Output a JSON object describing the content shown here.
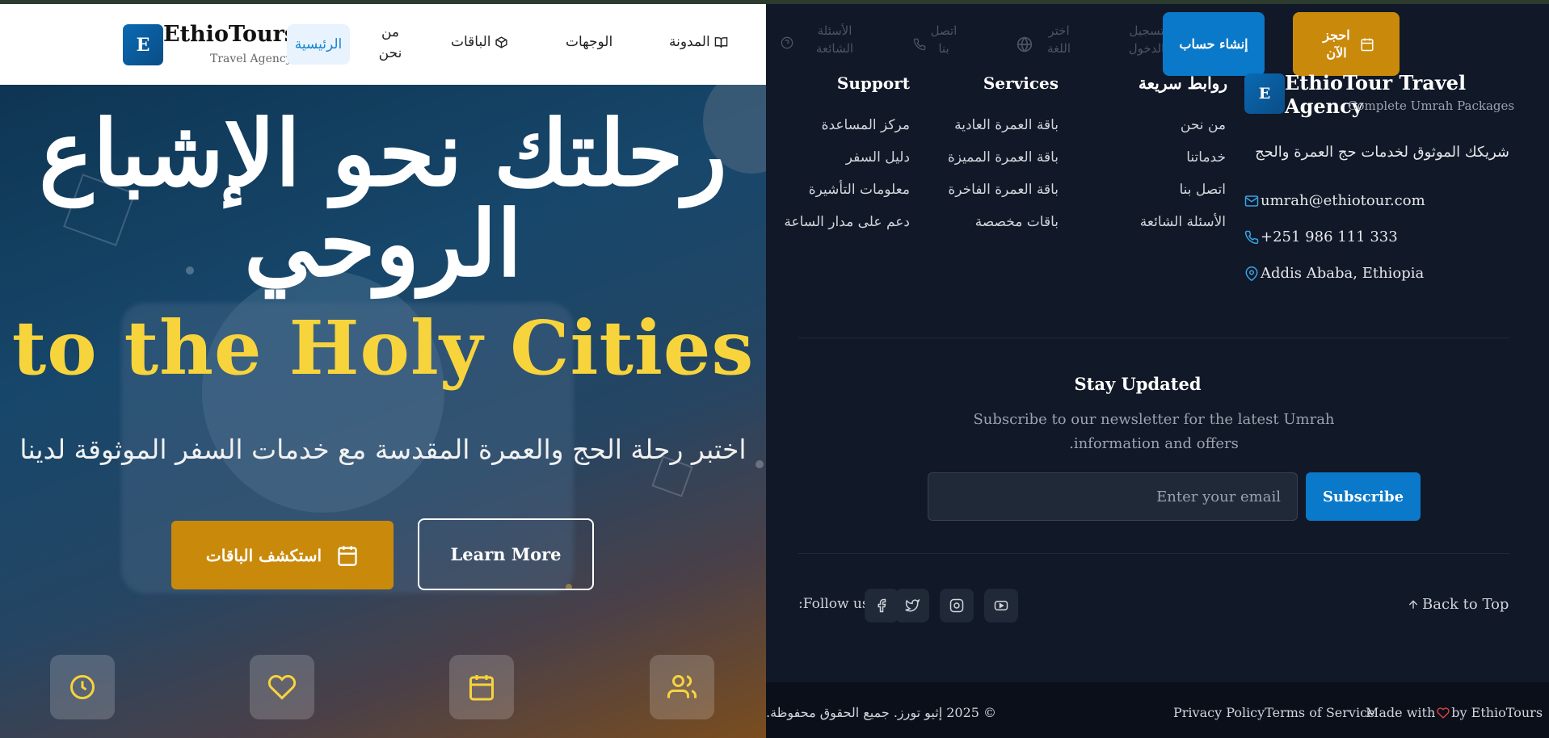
{
  "nav": {
    "brand": "EthioTours",
    "brand_sub": "Travel Agency",
    "logo_letter": "E",
    "home": "الرئيسية",
    "about": "من نحن",
    "packages": "الباقات",
    "destinations": "الوجهات",
    "blog": "المدونة",
    "faq": "الأسئلة الشائعة",
    "contact": "اتصل بنا",
    "language": "اختر اللغة",
    "login": "تسجيل الدخول",
    "signup": "إنشاء حساب",
    "book_now": "احجز الآن"
  },
  "hero": {
    "title_ar": "رحلتك نحو الإشباع الروحي",
    "title_en": "to the Holy Cities",
    "subtitle": "اختبر رحلة الحج والعمرة المقدسة مع خدمات السفر الموثوقة لدينا",
    "explore_button": "استكشف الباقات",
    "learn_button": "Learn More"
  },
  "footer": {
    "logo_letter": "E",
    "agency_name": "EthioTour Travel Agency",
    "agency_sub": "Complete Umrah Packages",
    "description": "شريكك الموثوق لخدمات حج العمرة والحج",
    "email": "umrah@ethiotour.com",
    "phone": "+251 986 111 333",
    "address": "Addis Ababa, Ethiopia",
    "quick_links": {
      "title": "روابط سريعة",
      "items": [
        "من نحن",
        "خدماتنا",
        "اتصل بنا",
        "الأسئلة الشائعة"
      ]
    },
    "services": {
      "title": "Services",
      "items": [
        "باقة العمرة العادية",
        "باقة العمرة المميزة",
        "باقة العمرة الفاخرة",
        "باقات مخصصة"
      ]
    },
    "support": {
      "title": "Support",
      "items": [
        "مركز المساعدة",
        "دليل السفر",
        "معلومات التأشيرة",
        "دعم على مدار الساعة"
      ]
    },
    "newsletter": {
      "title": "Stay Updated",
      "text": "Subscribe to our newsletter for the latest Umrah information and offers.",
      "placeholder": "Enter your email",
      "button": "Subscribe"
    },
    "follow_us": "Follow us:",
    "back_to_top": "Back to Top",
    "copyright": "© 2025 إثيو تورز. جميع الحقوق محفوظة.",
    "privacy": "Privacy Policy",
    "terms": "Terms of Service",
    "made_with": "Made with",
    "by": "by EthioTours"
  },
  "icons": {
    "social": [
      "facebook-icon",
      "twitter-icon",
      "instagram-icon",
      "youtube-icon"
    ],
    "features": [
      "clock-icon",
      "heart-icon",
      "calendar-icon",
      "users-icon"
    ]
  },
  "colors": {
    "primary": "#0a79c9",
    "gold": "#c98a0c",
    "hero_yellow": "#f7d43c",
    "footer_bg": "#111827"
  }
}
